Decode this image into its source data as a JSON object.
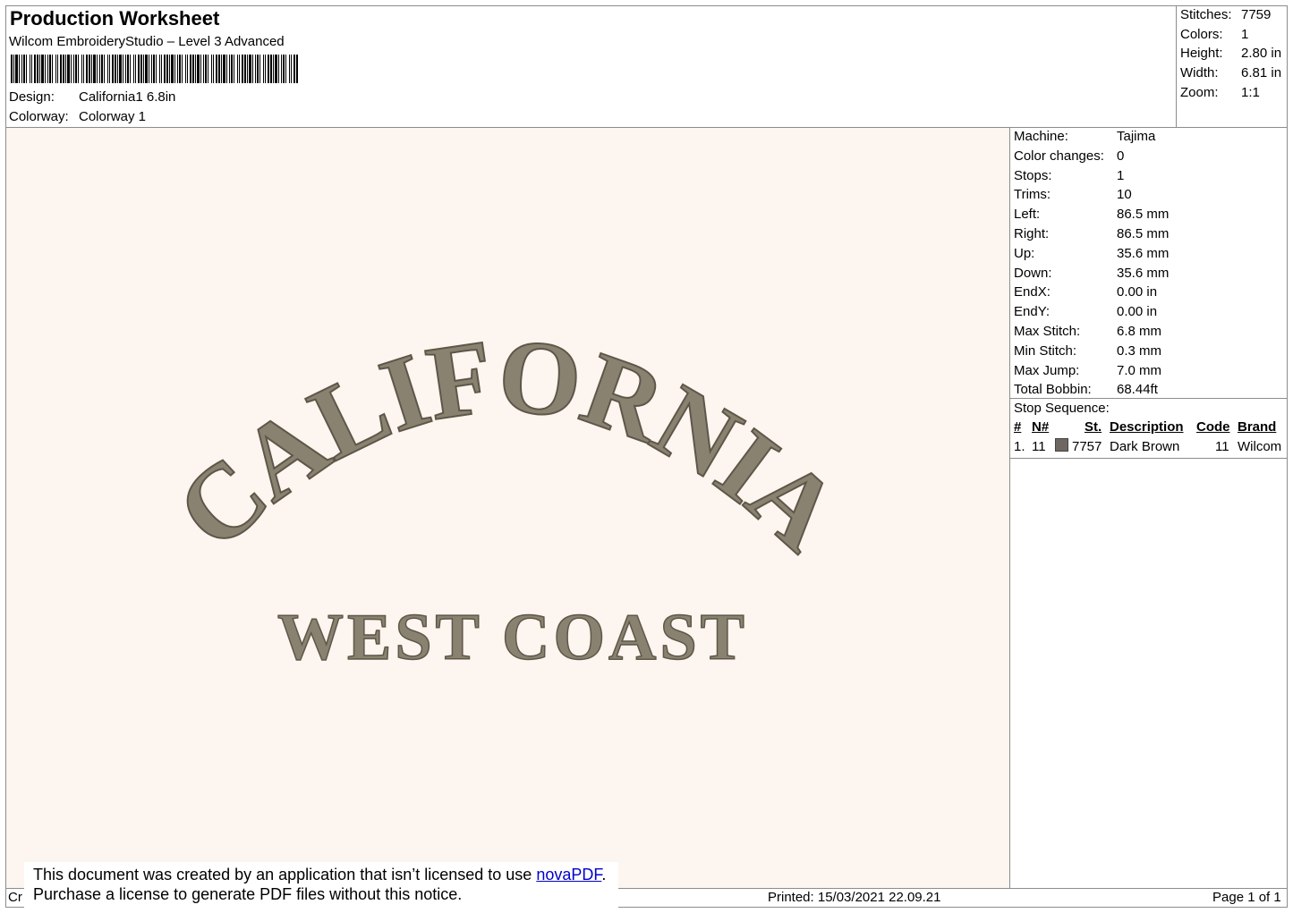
{
  "header": {
    "title": "Production Worksheet",
    "subtitle": "Wilcom EmbroideryStudio – Level 3 Advanced",
    "design_label": "Design:",
    "design_value": "California1 6.8in",
    "colorway_label": "Colorway:",
    "colorway_value": "Colorway 1"
  },
  "summary": [
    {
      "label": "Stitches:",
      "value": "7759"
    },
    {
      "label": "Colors:",
      "value": "1"
    },
    {
      "label": "Height:",
      "value": "2.80 in"
    },
    {
      "label": "Width:",
      "value": "6.81 in"
    },
    {
      "label": "Zoom:",
      "value": "1:1"
    }
  ],
  "machine_info": [
    {
      "label": "Machine:",
      "value": "Tajima"
    },
    {
      "label": "Color changes:",
      "value": "0"
    },
    {
      "label": "Stops:",
      "value": "1"
    },
    {
      "label": "Trims:",
      "value": "10"
    },
    {
      "label": "Left:",
      "value": "86.5 mm"
    },
    {
      "label": "Right:",
      "value": "86.5 mm"
    },
    {
      "label": "Up:",
      "value": "35.6 mm"
    },
    {
      "label": "Down:",
      "value": "35.6 mm"
    },
    {
      "label": "EndX:",
      "value": "0.00 in"
    },
    {
      "label": "EndY:",
      "value": "0.00 in"
    },
    {
      "label": "Max Stitch:",
      "value": "6.8 mm"
    },
    {
      "label": "Min Stitch:",
      "value": "0.3 mm"
    },
    {
      "label": "Max Jump:",
      "value": "7.0 mm"
    },
    {
      "label": "Total Bobbin:",
      "value": "68.44ft"
    }
  ],
  "stop_sequence": {
    "title": "Stop Sequence:",
    "headers": {
      "num": "#",
      "n": "N#",
      "st": "St.",
      "description": "Description",
      "code": "Code",
      "brand": "Brand"
    },
    "row": {
      "num": "1.",
      "n": "11",
      "swatch_color": "#6e6660",
      "st": "7757",
      "description": "Dark Brown",
      "code": "11",
      "brand": "Wilcom"
    }
  },
  "design": {
    "arc_text": "CALIFORNIA",
    "line_text": "WEST COAST",
    "thread_color": "#8a8270",
    "background": "#fdf5ef"
  },
  "notice": {
    "line1_prefix": "This document was created by an application that isn’t licensed to use ",
    "link": "novaPDF",
    "line1_suffix": ".",
    "line2": "Purchase a license to generate PDF files without this notice."
  },
  "footer": {
    "left": "Cr",
    "printed": "Printed: 15/03/2021 22.09.21",
    "page": "Page 1 of 1"
  }
}
